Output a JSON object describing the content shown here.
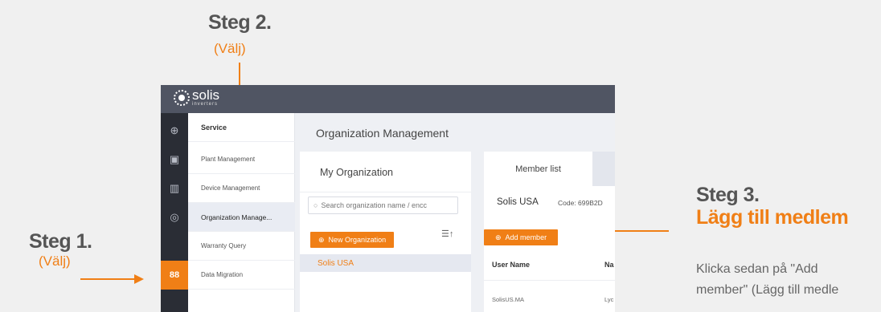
{
  "annotations": {
    "step1": {
      "title": "Steg 1.",
      "sub": "(Välj)"
    },
    "step2": {
      "title": "Steg 2.",
      "sub": "(Välj)"
    },
    "step3": {
      "title": "Steg 3.",
      "action": "Lägg till medlem",
      "desc_line1": "Klicka sedan på \"Add",
      "desc_line2": "member\" (Lägg till medle"
    },
    "accent_color": "#f07f16"
  },
  "app": {
    "brand": {
      "name": "solis",
      "sub": "inverters"
    },
    "iconbar": [
      {
        "icon": "plant-icon",
        "glyph": "⊕"
      },
      {
        "icon": "device-icon",
        "glyph": "▣"
      },
      {
        "icon": "chart-icon",
        "glyph": "▥"
      },
      {
        "icon": "eye-icon",
        "glyph": "◎"
      },
      {
        "icon": "service-icon",
        "glyph": "88",
        "active": true
      }
    ],
    "menu": {
      "header": "Service",
      "items": [
        "Plant Management",
        "Device Management",
        "Organization Manage...",
        "Warranty Query",
        "Data Migration"
      ],
      "active_index": 2
    },
    "page_title": "Organization Management",
    "org_panel": {
      "title": "My Organization",
      "search_placeholder": "Search organization name / encc",
      "new_button": "New Organization",
      "sort_glyph": "☰↑",
      "rows": [
        "Solis USA"
      ]
    },
    "member_panel": {
      "tab": "Member list",
      "org_name": "Solis USA",
      "org_code": "Code: 699B2D",
      "add_button": "Add member",
      "columns": [
        "User Name",
        "Na"
      ],
      "rows": [
        [
          "SolisUS.MA",
          "Lyc"
        ]
      ]
    }
  }
}
